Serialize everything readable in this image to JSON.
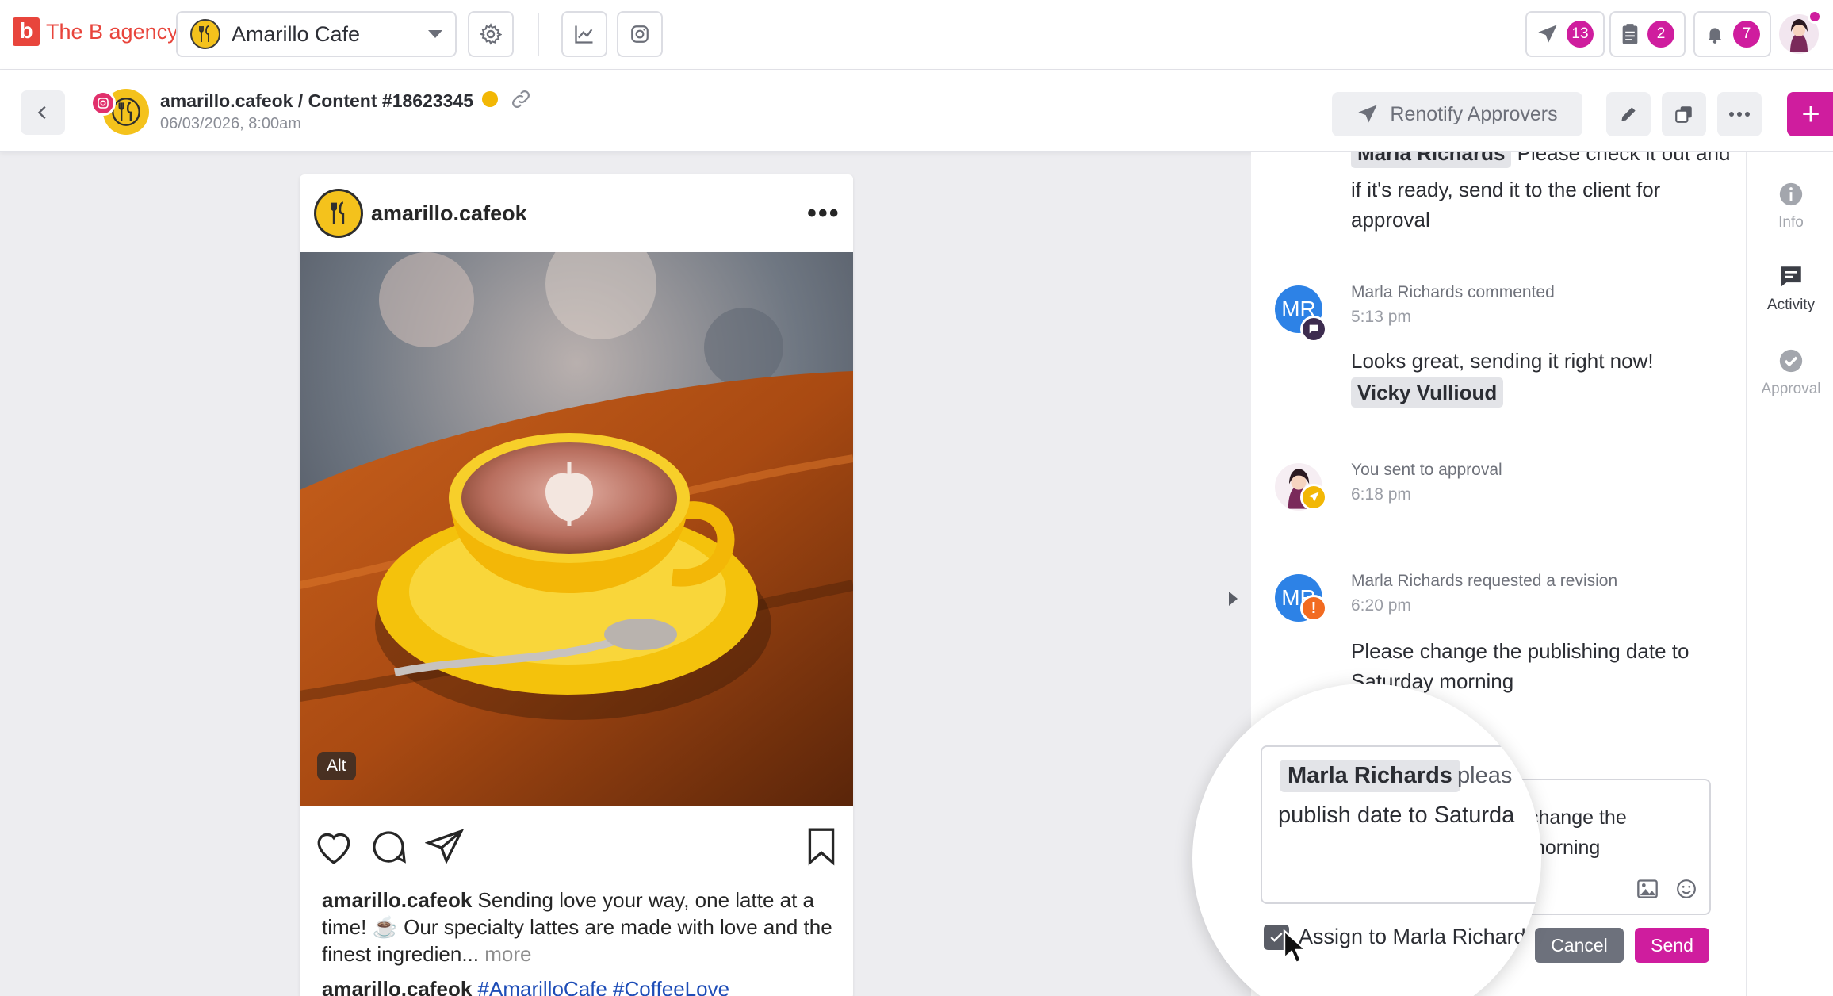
{
  "brand": {
    "logo_letter": "b",
    "name": "The B agency",
    "color": "#e8453c"
  },
  "header": {
    "client_name": "Amarillo Cafe",
    "badges": {
      "send": "13",
      "tasks": "2",
      "notifications": "7"
    },
    "accent": "#cf1d9e"
  },
  "subheader": {
    "title": "amarillo.cafeok / Content #18623345",
    "date": "06/03/2026, 8:00am",
    "renotify_label": "Renotify Approvers",
    "plus": "+"
  },
  "post": {
    "username": "amarillo.cafeok",
    "more": "•••",
    "alt": "Alt",
    "caption_user": "amarillo.cafeok",
    "caption_text": "Sending love your way, one latte at a time! ☕ Our specialty lattes are made with love and the finest ingredien...",
    "caption_more": "more",
    "second_user": "amarillo.cafeok",
    "hashtags": "#AmarilloCafe #CoffeeLove"
  },
  "activity": {
    "item0": {
      "mention": "Marla Richards",
      "text_a": "Please check it out and",
      "text_b": "if it's ready, send it to the client for",
      "text_c": "approval"
    },
    "item1": {
      "initials": "MR",
      "meta": "Marla Richards commented",
      "time": "5:13 pm",
      "text": "Looks great, sending it right now!",
      "mention": "Vicky Vullioud"
    },
    "item2": {
      "meta": "You sent to approval",
      "time": "6:18 pm"
    },
    "item3": {
      "initials": "MR",
      "meta": "Marla Richards requested a revision",
      "time": "6:20 pm",
      "text_a": "Please change the publishing date to",
      "text_b": "Saturday morning"
    }
  },
  "composer": {
    "mention": "Marla Richards",
    "tail": "pleas",
    "line2": "publish date to Saturda",
    "visible_right_a": "change the",
    "visible_right_b": "morning",
    "assign_label": "Assign to Marla Richard",
    "cancel": "Cancel",
    "send": "Send"
  },
  "rail": {
    "info": "Info",
    "activity": "Activity",
    "approval": "Approval"
  }
}
